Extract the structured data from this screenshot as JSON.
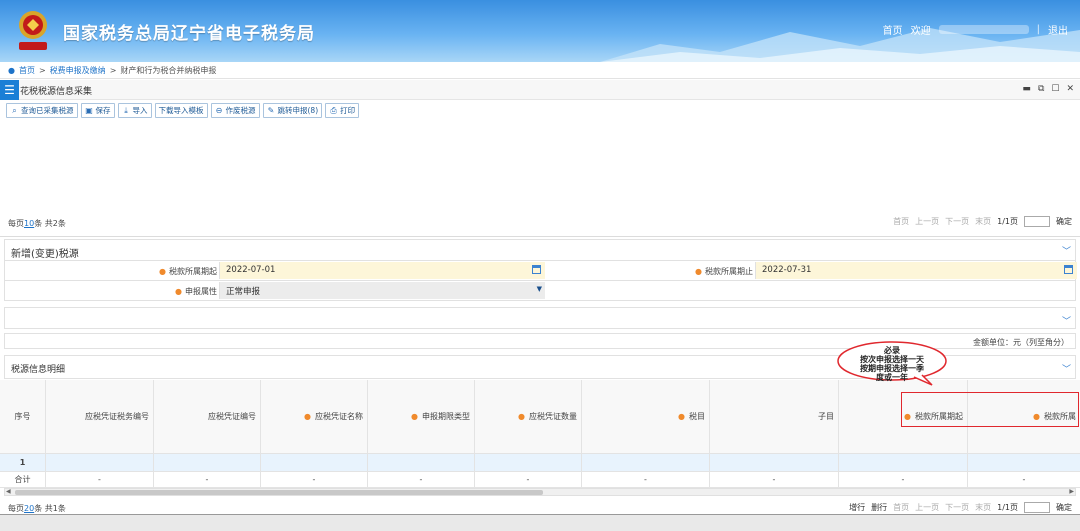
{
  "header": {
    "site_title": "国家税务总局辽宁省电子税务局",
    "nav_home": "首页",
    "welcome": "欢迎",
    "logout": "退出",
    "emblem_caption": "中国税务"
  },
  "breadcrumb": {
    "home": "首页",
    "level1": "税费申报及缴纳",
    "current": "财产和行为税合并纳税申报"
  },
  "panel": {
    "title": "花税税源信息采集",
    "menu_icon": "list-icon"
  },
  "toolbar": [
    {
      "label": "查询已采集税源",
      "icon": "search-icon"
    },
    {
      "label": "保存",
      "icon": "save-icon"
    },
    {
      "label": "导入",
      "icon": "import-icon"
    },
    {
      "label": "下载导入模板",
      "icon": ""
    },
    {
      "label": "作废税源",
      "icon": "void-icon"
    },
    {
      "label": "跳转申报(8)",
      "icon": "edit-icon"
    },
    {
      "label": "打印",
      "icon": "print-icon"
    }
  ],
  "top_pager": {
    "prefix": "每页",
    "page_size": "10",
    "suffix": "条 共2条",
    "first": "首页",
    "prev": "上一页",
    "next": "下一页",
    "last": "末页",
    "page_info": "1/1页",
    "confirm": "确定"
  },
  "new_source": {
    "title": "新增(变更)税源",
    "period_start_label": "税款所属期起",
    "period_start_value": "2022-07-01",
    "period_end_label": "税款所属期止",
    "period_end_value": "2022-07-31",
    "decl_attr_label": "申报属性",
    "decl_attr_value": "正常申报"
  },
  "unit_text": "金额单位：元（列至角分）",
  "detail": {
    "title": "税源信息明细",
    "columns": [
      {
        "label": "序号",
        "required": false
      },
      {
        "label": "应税凭证税务编号",
        "required": false
      },
      {
        "label": "应税凭证编号",
        "required": false
      },
      {
        "label": "应税凭证名称",
        "required": true
      },
      {
        "label": "申报期限类型",
        "required": true
      },
      {
        "label": "应税凭证数量",
        "required": true
      },
      {
        "label": "税目",
        "required": true
      },
      {
        "label": "子目",
        "required": false
      },
      {
        "label": "税款所属期起",
        "required": true
      },
      {
        "label": "税款所属",
        "required": true
      }
    ],
    "row1_index": "1",
    "total_label": "合计",
    "dash": "-"
  },
  "bottom_pager": {
    "prefix": "每页",
    "page_size": "20",
    "suffix": "条 共1条",
    "add_row": "增行",
    "del_row": "删行",
    "first": "首页",
    "prev": "上一页",
    "next": "下一页",
    "last": "末页",
    "page_info": "1/1页",
    "confirm": "确定"
  },
  "annotation": {
    "line1": "必录",
    "line2": "按次申报选择一天",
    "line3": "按期申报选择一季",
    "line4": "度或一年"
  },
  "colors": {
    "accent": "#1e73c8",
    "required": "#f08a2c",
    "highlight": "#e0282e"
  }
}
